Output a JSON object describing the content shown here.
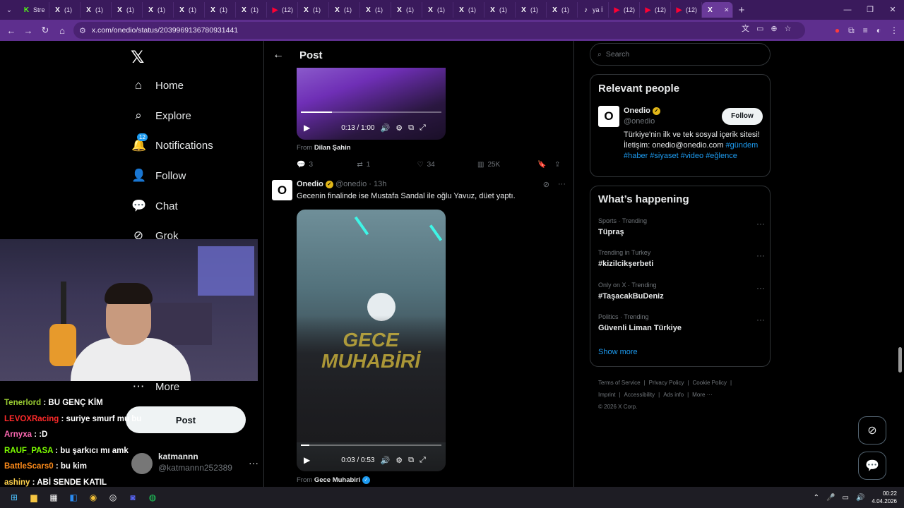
{
  "browser": {
    "tabs": [
      {
        "label": "Stre",
        "icon": "K",
        "color": "#53fc18"
      },
      {
        "label": "(1)",
        "icon": "X",
        "color": "#ffffff"
      },
      {
        "label": "(1)",
        "icon": "X",
        "color": "#ffffff"
      },
      {
        "label": "(1)",
        "icon": "X",
        "color": "#ffffff"
      },
      {
        "label": "(1)",
        "icon": "X",
        "color": "#ffffff"
      },
      {
        "label": "(1)",
        "icon": "X",
        "color": "#ffffff"
      },
      {
        "label": "(1)",
        "icon": "X",
        "color": "#ffffff"
      },
      {
        "label": "(1)",
        "icon": "X",
        "color": "#ffffff"
      },
      {
        "label": "(12)",
        "icon": "▶",
        "color": "#ff0033"
      },
      {
        "label": "(1)",
        "icon": "X",
        "color": "#ffffff"
      },
      {
        "label": "(1)",
        "icon": "X",
        "color": "#ffffff"
      },
      {
        "label": "(1)",
        "icon": "X",
        "color": "#ffffff"
      },
      {
        "label": "(1)",
        "icon": "X",
        "color": "#ffffff"
      },
      {
        "label": "(1)",
        "icon": "X",
        "color": "#ffffff"
      },
      {
        "label": "(1)",
        "icon": "X",
        "color": "#ffffff"
      },
      {
        "label": "(1)",
        "icon": "X",
        "color": "#ffffff"
      },
      {
        "label": "(1)",
        "icon": "X",
        "color": "#ffffff"
      },
      {
        "label": "(1)",
        "icon": "X",
        "color": "#ffffff"
      },
      {
        "label": "ya İ",
        "icon": "♪",
        "color": "#ffffff"
      },
      {
        "label": "(12)",
        "icon": "▶",
        "color": "#ff0033"
      },
      {
        "label": "(12)",
        "icon": "▶",
        "color": "#ff0033"
      },
      {
        "label": "(12)",
        "icon": "▶",
        "color": "#ff0033"
      }
    ],
    "active_tab_icon": "X",
    "url": "x.com/onedio/status/2039969136780931441"
  },
  "sidebar": {
    "items": [
      {
        "label": "Home",
        "icon": "⌂",
        "name": "home"
      },
      {
        "label": "Explore",
        "icon": "⌕",
        "name": "explore"
      },
      {
        "label": "Notifications",
        "icon": "🔔",
        "name": "notifications",
        "badge": "12"
      },
      {
        "label": "Follow",
        "icon": "👤",
        "name": "follow"
      },
      {
        "label": "Chat",
        "icon": "💬",
        "name": "chat"
      },
      {
        "label": "Grok",
        "icon": "⊘",
        "name": "grok"
      },
      {
        "label": "More",
        "icon": "⋯",
        "name": "more"
      }
    ],
    "post_label": "Post",
    "account": {
      "name": "katmannn",
      "handle": "@katmannn252389"
    }
  },
  "stream_chat": [
    {
      "user": "Tenerlord",
      "color": "#9acd32",
      "msg": " : BU GENÇ KİM"
    },
    {
      "user": "LEVOXRacing",
      "color": "#ff2a2a",
      "msg": " : suriye smurf mu bu"
    },
    {
      "user": "Arnyxa",
      "color": "#ff69b4",
      "msg": " : :D"
    },
    {
      "user": "RAUF_PASA",
      "color": "#7cfc00",
      "msg": " : bu şarkıcı mı amk"
    },
    {
      "user": "BattleScars0",
      "color": "#ff8c1a",
      "msg": " : bu kim"
    },
    {
      "user": "ashiny",
      "color": "#ffd24d",
      "msg": " : ABİ SENDE KATIL"
    }
  ],
  "main": {
    "header_title": "Post",
    "tweet1": {
      "video_time": "0:13 / 1:00",
      "video_progress": 0.22,
      "from_prefix": "From",
      "from_name": "Dilan Şahin",
      "replies": "3",
      "reposts": "1",
      "likes": "34",
      "views": "25K"
    },
    "tweet2": {
      "name": "Onedio",
      "handle": "@onedio · 13h",
      "text": "Gecenin finalinde ise Mustafa Sandal ile oğlu Yavuz, düet yaptı.",
      "watermark": "GECE MUHABİRİ",
      "video_time": "0:03 / 0:53",
      "video_progress": 0.06,
      "from_prefix": "From",
      "from_name": "Gece Muhabiri"
    }
  },
  "right": {
    "search_placeholder": "Search",
    "relevant_title": "Relevant people",
    "person": {
      "name": "Onedio",
      "handle": "@onedio",
      "follow_label": "Follow",
      "bio": "Türkiye'nin ilk ve tek sosyal içerik sitesi! İletişim: onedio@onedio.com",
      "hashtags": "#gündem #haber #siyaset #video #eğlence"
    },
    "happening_title": "What’s happening",
    "trends": [
      {
        "context": "Sports · Trending",
        "title": "Tüpraş"
      },
      {
        "context": "Trending in Turkey",
        "title": "#kizilcikşerbeti"
      },
      {
        "context": "Only on X · Trending",
        "title": "#TaşacakBuDeniz"
      },
      {
        "context": "Politics · Trending",
        "title": "Güvenli Liman Türkiye"
      }
    ],
    "show_more": "Show more",
    "footer": {
      "line1": [
        "Terms of Service",
        "|",
        "Privacy Policy",
        "|",
        "Cookie Policy",
        "|"
      ],
      "line2": [
        "Imprint",
        "|",
        "Accessibility",
        "|",
        "Ads info",
        "|",
        "More ···"
      ],
      "copyright": "© 2026 X Corp."
    }
  },
  "taskbar": {
    "time": "00:22",
    "date": "4.04.2026"
  },
  "colors": {
    "accent": "#1d9bf0",
    "browser_frame": "#3a1a5c",
    "browser_toolbar": "#5e2f8e"
  }
}
